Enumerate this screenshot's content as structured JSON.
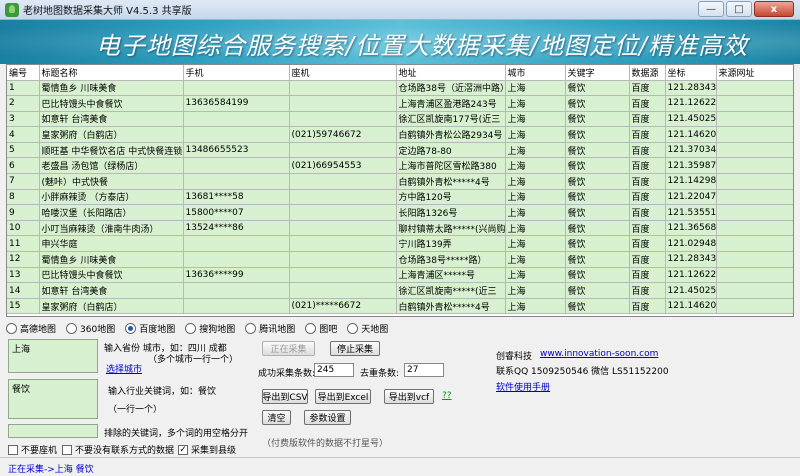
{
  "window": {
    "title": "老树地图数据采集大师 V4.5.3 共享版",
    "minimize_glyph": "—",
    "maximize_glyph": "□",
    "close_glyph": "x"
  },
  "banner": {
    "text": "电子地图综合服务搜索/位置大数据采集/地图定位/精准高效"
  },
  "table": {
    "headers": [
      "编号",
      "标题名称",
      "手机",
      "座机",
      "地址",
      "城市",
      "关键字",
      "数据源",
      "坐标",
      "来源网址"
    ],
    "rows": [
      [
        "1",
        "蜀情鱼乡 川味美食",
        "",
        "",
        "仓场路38号（近滘洲中路）",
        "上海",
        "餐饮",
        "百度",
        "121.283435,",
        ""
      ],
      [
        "2",
        "巴比特馒头中食餐饮",
        "13636584199",
        "",
        "上海青浦区盈港路243号",
        "上海",
        "餐饮",
        "百度",
        "121.126222,",
        ""
      ],
      [
        "3",
        "如意轩 台湾美食",
        "",
        "",
        "徐汇区凯旋南177号(近三",
        "上海",
        "餐饮",
        "百度",
        "121.450259,",
        ""
      ],
      [
        "4",
        "皇家粥府（白鹤店）",
        "",
        "(021)59746672",
        "白鹤镇外青松公路2934号",
        "上海",
        "餐饮",
        "百度",
        "121.146208,",
        ""
      ],
      [
        "5",
        "顺旺基 中华餐饮名店 中式快餐连锁",
        "13486655523",
        "",
        "定边路78-80",
        "上海",
        "餐饮",
        "百度",
        "121.370343,",
        ""
      ],
      [
        "6",
        "老盛昌 汤包馆（绿杨店）",
        "",
        "(021)66954553",
        "上海市普陀区雪松路380",
        "上海",
        "餐饮",
        "百度",
        "121.359878,",
        ""
      ],
      [
        "7",
        "(魅咔）中式快餐",
        "",
        "",
        "白鹤镇外青松*****4号",
        "上海",
        "餐饮",
        "百度",
        "121.142988,",
        ""
      ],
      [
        "8",
        "小胖麻辣烫 （方泰店）",
        "13681****58",
        "",
        "方中路120号",
        "上海",
        "餐饮",
        "百度",
        "121.220479,",
        ""
      ],
      [
        "9",
        "哈喽汉堡（长阳路店）",
        "15800****07",
        "",
        "长阳路1326号",
        "上海",
        "餐饮",
        "百度",
        "121.535518,",
        ""
      ],
      [
        "10",
        "小叮当麻辣烫（淮南牛肉汤）",
        "13524****86",
        "",
        "聊村镇蒂太路*****(兴尚购",
        "上海",
        "餐饮",
        "百度",
        "121.365687,",
        ""
      ],
      [
        "11",
        "申兴华庭",
        "",
        "",
        "宁川路139弄",
        "上海",
        "餐饮",
        "百度",
        "121.029481,",
        ""
      ],
      [
        "12",
        "蜀情鱼乡 川味美食",
        "",
        "",
        "仓场路38号*****路）",
        "上海",
        "餐饮",
        "百度",
        "121.283435,",
        ""
      ],
      [
        "13",
        "巴比特馒头中食餐饮",
        "13636****99",
        "",
        "上海青浦区*****号",
        "上海",
        "餐饮",
        "百度",
        "121.126222,",
        ""
      ],
      [
        "14",
        "如意轩 台湾美食",
        "",
        "",
        "徐汇区凯旋南*****(近三",
        "上海",
        "餐饮",
        "百度",
        "121.450259,",
        ""
      ],
      [
        "15",
        "皇家粥府（白鹤店）",
        "",
        "(021)*****6672",
        "白鹤镇外青松*****4号",
        "上海",
        "餐饮",
        "百度",
        "121.146208,",
        ""
      ]
    ]
  },
  "sources": [
    {
      "label": "高德地图",
      "selected": false
    },
    {
      "label": "360地图",
      "selected": false
    },
    {
      "label": "百度地图",
      "selected": true
    },
    {
      "label": "搜狗地图",
      "selected": false
    },
    {
      "label": "腾讯地图",
      "selected": false
    },
    {
      "label": "图吧",
      "selected": false
    },
    {
      "label": "天地图",
      "selected": false
    }
  ],
  "city": {
    "value": "上海",
    "hint1": "输入省份 城市，如：四川 成都",
    "hint2": "（多个城市一行一个）",
    "select_link": "选择城市"
  },
  "keyword": {
    "value": "餐饮",
    "hint1": "输入行业关键词，如：餐饮",
    "hint2": "（一行一个）"
  },
  "exclude": {
    "value": "",
    "hint": "排除的关键词，多个词的用空格分开"
  },
  "controls": {
    "collecting": "正在采集",
    "stop": "停止采集",
    "success_label": "成功采集条数:",
    "success_count": "245",
    "dedupe_label": "去重条数:",
    "dedupe_count": "27",
    "export_csv": "导出到CSV",
    "export_excel": "导出到Excel",
    "export_vcf": "导出到vcf",
    "help_link": "??",
    "clear": "清空",
    "settings": "参数设置",
    "paid_note": "（付费版软件的数据不打星号）"
  },
  "checkboxes": [
    {
      "label": "不要座机",
      "checked": false
    },
    {
      "label": "不要没有联系方式的数据",
      "checked": false
    },
    {
      "label": "采集到县级",
      "checked": true
    }
  ],
  "info": {
    "company": "创睿科技",
    "website": "www.innovation-soon.com",
    "contact": "联系QQ 1509250546  微信 LS51152200",
    "manual": "软件使用手册"
  },
  "status": {
    "text": "正在采集->上海 餐饮"
  },
  "colors": {
    "grid_cell": "#d7f0cf",
    "banner": "#2f9fc0",
    "link": "#0000cc"
  }
}
